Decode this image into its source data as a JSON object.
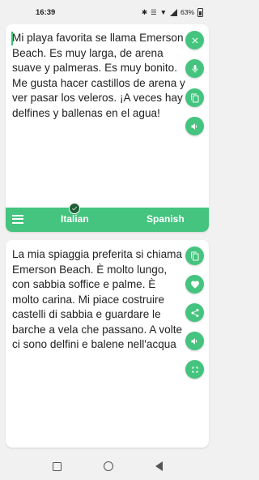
{
  "status_bar": {
    "time": "16:39",
    "battery_percent": "63%",
    "icons": [
      "bluetooth-icon",
      "vibrate-icon",
      "wifi-icon",
      "signal-icon",
      "battery-icon"
    ]
  },
  "source": {
    "text": "Mi playa favorita se llama Emerson Beach. Es muy larga, de arena suave y palmeras. Es muy bonito. Me gusta hacer castillos de arena y ver pasar los veleros. ¡A veces hay delfines y ballenas en el agua!",
    "actions": [
      "clear-icon",
      "microphone-icon",
      "copy-icon",
      "speaker-icon"
    ]
  },
  "language_bar": {
    "source_language": "Italian",
    "target_language": "Spanish"
  },
  "translation": {
    "text": "La mia spiaggia preferita si chiama Emerson Beach. È molto lungo, con sabbia soffice e palme. È molto carina. Mi piace costruire castelli di sabbia e guardare le barche a vela che passano. A volte ci sono delfini e balene nell'acqua",
    "actions": [
      "copy-icon",
      "heart-icon",
      "share-icon",
      "speaker-icon",
      "fullscreen-icon"
    ]
  },
  "colors": {
    "accent": "#44c47e",
    "badge": "#1e5f36",
    "background": "#f1f1f1",
    "text": "#222222"
  }
}
